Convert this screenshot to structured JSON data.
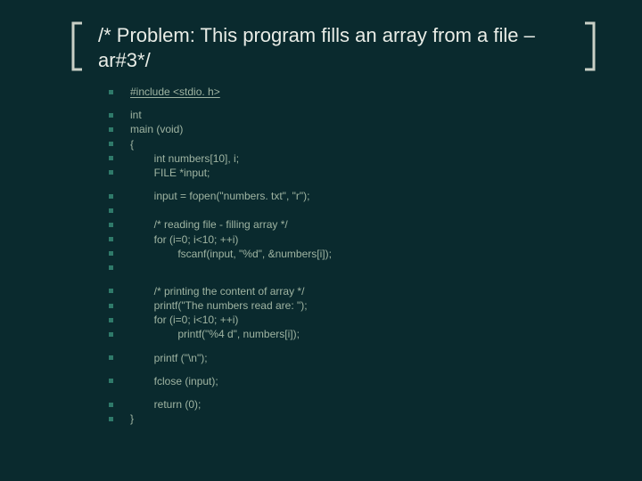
{
  "title": "/* Problem: This program fills an array from a file –ar#3*/",
  "lines": [
    {
      "text": "#include <stdio. h>",
      "underline": true,
      "indent": 0
    },
    {
      "gap": true
    },
    {
      "text": "int",
      "indent": 0
    },
    {
      "text": "main (void)",
      "indent": 0
    },
    {
      "text": "{",
      "indent": 0
    },
    {
      "text": "        int numbers[10], i;",
      "indent": 0
    },
    {
      "text": "        FILE *input;",
      "indent": 0
    },
    {
      "gap": true
    },
    {
      "text": "        input = fopen(\"numbers. txt\", \"r\");",
      "indent": 0
    },
    {
      "text": "",
      "indent": 0
    },
    {
      "text": "        /* reading file - filling array */",
      "indent": 0
    },
    {
      "text": "        for (i=0; i<10; ++i)",
      "indent": 0
    },
    {
      "text": "                fscanf(input, \"%d\", &numbers[i]);",
      "indent": 0
    },
    {
      "text": "",
      "indent": 0
    },
    {
      "gap": true
    },
    {
      "text": "        /* printing the content of array */",
      "indent": 0
    },
    {
      "text": "        printf(\"The numbers read are: \");",
      "indent": 0
    },
    {
      "text": "        for (i=0; i<10; ++i)",
      "indent": 0
    },
    {
      "text": "                printf(\"%4 d\", numbers[i]);",
      "indent": 0
    },
    {
      "gap": true
    },
    {
      "text": "        printf (\"\\n\");",
      "indent": 0
    },
    {
      "gap": true
    },
    {
      "text": "        fclose (input);",
      "indent": 0
    },
    {
      "gap": true
    },
    {
      "text": "        return (0);",
      "indent": 0
    },
    {
      "text": "}",
      "indent": 0
    }
  ]
}
